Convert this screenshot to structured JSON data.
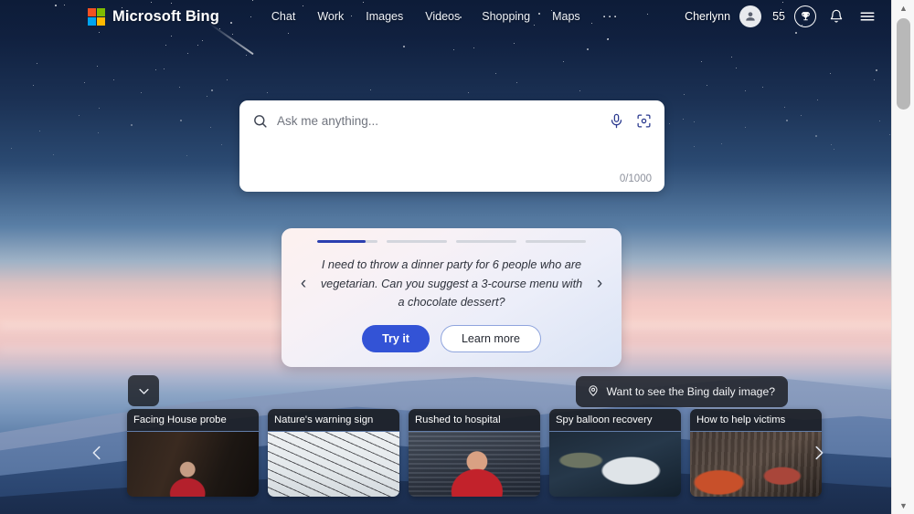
{
  "brand": {
    "name": "Microsoft Bing",
    "logo_icon": "microsoft-logo-icon"
  },
  "nav": {
    "items": [
      {
        "label": "Chat"
      },
      {
        "label": "Work"
      },
      {
        "label": "Images"
      },
      {
        "label": "Videos"
      },
      {
        "label": "Shopping"
      },
      {
        "label": "Maps"
      }
    ],
    "more_label": "···"
  },
  "account": {
    "user_name": "Cherlynn",
    "avatar_icon": "person-avatar-icon",
    "rewards_points": "55",
    "rewards_icon": "trophy-icon",
    "notifications_icon": "bell-icon",
    "menu_icon": "hamburger-menu-icon"
  },
  "search": {
    "placeholder": "Ask me anything...",
    "value": "",
    "search_icon": "search-icon",
    "mic_icon": "microphone-icon",
    "camera_icon": "visual-search-camera-icon",
    "counter": "0/1000"
  },
  "suggestion": {
    "progress": [
      80,
      0,
      0,
      0
    ],
    "prev_icon": "chevron-left-icon",
    "next_icon": "chevron-right-icon",
    "text": "I need to throw a dinner party for 6 people who are vegetarian. Can you suggest a 3-course menu with a chocolate dessert?",
    "primary_label": "Try it",
    "secondary_label": "Learn more",
    "primary_color": "#3353d6"
  },
  "daily_image": {
    "label": "Want to see the Bing daily image?",
    "icon": "location-pin-icon"
  },
  "collapse_toggle": {
    "icon": "chevron-down-icon"
  },
  "news": {
    "prev_icon": "chevron-left-icon",
    "next_icon": "chevron-right-icon",
    "cards": [
      {
        "title": "Facing House probe"
      },
      {
        "title": "Nature's warning sign"
      },
      {
        "title": "Rushed to hospital"
      },
      {
        "title": "Spy balloon recovery"
      },
      {
        "title": "How to help victims"
      }
    ]
  },
  "scrollbar": {
    "up_icon": "scroll-up-arrow-icon",
    "down_icon": "scroll-down-arrow-icon"
  }
}
